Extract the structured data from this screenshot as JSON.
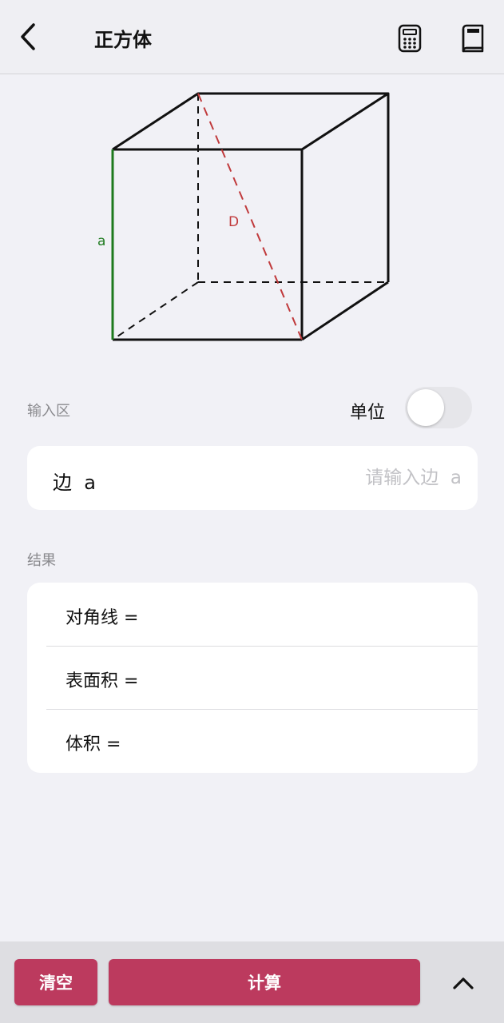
{
  "header": {
    "title": "正方体",
    "icons": [
      "back-arrow-icon",
      "calculator-icon",
      "book-icon"
    ]
  },
  "diagram": {
    "edge_label": "a",
    "diagonal_label": "D",
    "colors": {
      "edge": "#1e7a1e",
      "diagonal": "#c0393b",
      "lines": "#111111"
    }
  },
  "input_section": {
    "label": "输入区",
    "unit_label": "单位",
    "unit_toggle_on": false,
    "fields": [
      {
        "label": "边  a",
        "value": "",
        "placeholder": "请输入边  a"
      }
    ]
  },
  "results_section": {
    "label": "结果",
    "rows": [
      {
        "text": "对角线 ="
      },
      {
        "text": "表面积 ="
      },
      {
        "text": "体积 ="
      }
    ]
  },
  "bottom_bar": {
    "clear_label": "清空",
    "compute_label": "计算",
    "collapse_icon": "chevron-up-icon"
  },
  "colors": {
    "accent": "#bc3a5e",
    "background": "#f1f1f6",
    "card": "#ffffff"
  }
}
